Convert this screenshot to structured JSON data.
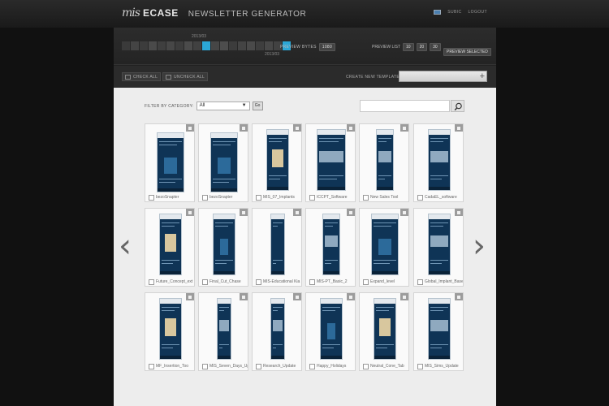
{
  "header": {
    "logo_mark": "mis",
    "app_name": "ECASE",
    "title": "NEWSLETTER GENERATOR",
    "user_label": "SUBIC",
    "logout_label": "LOGOUT"
  },
  "timeline": {
    "top_label": "2013/03",
    "bottom_label": "2013/03",
    "colors": [
      "#3a3a3a",
      "#444444",
      "#3c3c3c",
      "#4a4a4a",
      "#3f3f3f",
      "#474747",
      "#3d3d3d",
      "#4b4b4b",
      "#414141",
      "#2ba7d6",
      "#464646",
      "#4d4d4d",
      "#3c3c3c",
      "#444444",
      "#4a4a4a",
      "#3e3e3e",
      "#484848",
      "#424242",
      "#2ba7d6"
    ]
  },
  "toolbar": {
    "preview_bytes_label": "PREVIEW BYTES",
    "preview_bytes_value": "1080",
    "preview_list_label": "PREVIEW LIST",
    "preview_list_options": [
      "10",
      "20",
      "30"
    ],
    "preview_selected_label": "PREVIEW SELECTED",
    "check_all_label": "CHECK ALL",
    "uncheck_all_label": "UNCHECK ALL",
    "create_template_label": "CREATE NEW TEMPLATE"
  },
  "filter": {
    "label": "FILTER BY CATEGORY:",
    "selected": "All",
    "go_label": "Go"
  },
  "templates": [
    {
      "label": "bezoSnapter",
      "hero": "none"
    },
    {
      "label": "bezoSnapter",
      "hero": "none"
    },
    {
      "label": "MIS_07_Implants",
      "hero": "gold"
    },
    {
      "label": "ICCPT_Software",
      "hero": "photo"
    },
    {
      "label": "New Sales Tool",
      "hero": "photo"
    },
    {
      "label": "CadaEL_software",
      "hero": "photo"
    },
    {
      "label": "Future_Concept_ext",
      "hero": "gold"
    },
    {
      "label": "Final_Cut_Chase",
      "hero": "none"
    },
    {
      "label": "MIS-Educational Kia",
      "hero": "none"
    },
    {
      "label": "MIS-PT_Basic_2",
      "hero": "photo"
    },
    {
      "label": "Expand_level",
      "hero": "none"
    },
    {
      "label": "Global_Implant_Base",
      "hero": "photo"
    },
    {
      "label": "MF_Insertion_Too",
      "hero": "gold"
    },
    {
      "label": "MIS_Seven_Days_Up",
      "hero": "photo"
    },
    {
      "label": "Research_Update",
      "hero": "photo"
    },
    {
      "label": "Happy_Holidays",
      "hero": "none"
    },
    {
      "label": "Neutral_Cone_Tab",
      "hero": "gold"
    },
    {
      "label": "MIS_Sims_Update",
      "hero": "photo"
    }
  ]
}
